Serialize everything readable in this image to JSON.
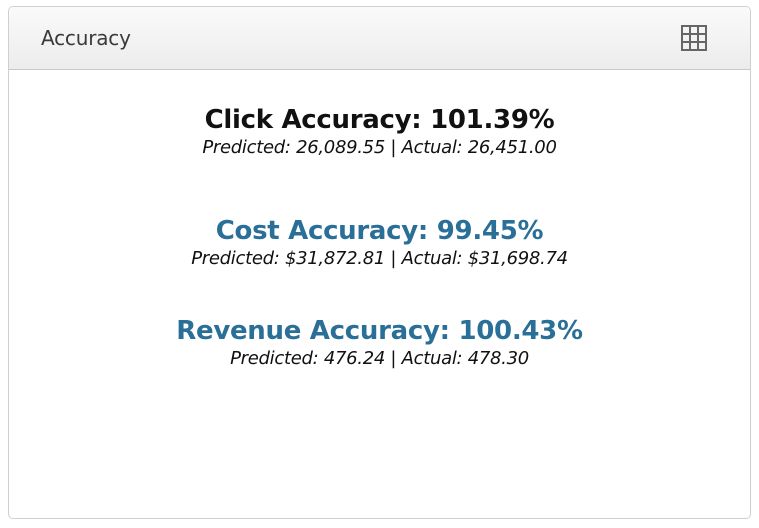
{
  "panel": {
    "title": "Accuracy",
    "menu_icon": "grid-icon"
  },
  "colors": {
    "click_title": "#111111",
    "cost_title": "#2a6f97",
    "revenue_title": "#2a6f97"
  },
  "metrics": [
    {
      "title": "Click Accuracy: 101.39%",
      "predicted_label": "Predicted:",
      "predicted_value": "26,089.55",
      "separator": "|",
      "actual_label": "Actual:",
      "actual_value": "26,451.00"
    },
    {
      "title": "Cost Accuracy: 99.45%",
      "predicted_label": "Predicted:",
      "predicted_value": "$31,872.81",
      "separator": "|",
      "actual_label": "Actual:",
      "actual_value": "$31,698.74"
    },
    {
      "title": "Revenue Accuracy: 100.43%",
      "predicted_label": "Predicted:",
      "predicted_value": "476.24",
      "separator": "|",
      "actual_label": "Actual:",
      "actual_value": "478.30"
    }
  ]
}
